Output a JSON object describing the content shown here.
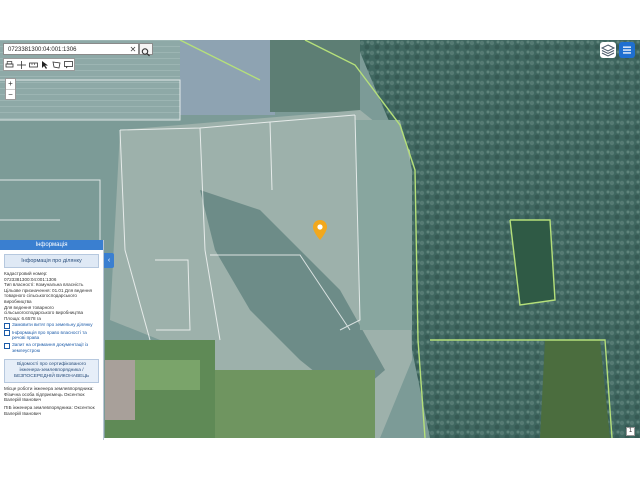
{
  "search": {
    "value": "0723381300:04:001:1306"
  },
  "icons": {
    "search": "magnifier-icon",
    "clear": "close-icon",
    "layers": "layers-icon",
    "menu": "hamburger-icon",
    "pin": "map-pin-icon"
  },
  "zoom": {
    "in_label": "+",
    "out_label": "−"
  },
  "info_panel": {
    "header": "Інформація",
    "title": "Інформація про ділянку",
    "lines": [
      "Кадастровий номер:",
      "0723381300:04:001:1306",
      "Тип власності: Комунальна власність",
      "Цільове призначення: 01.01 Для ведення товарного сільськогосподарського виробництва",
      "Для ведення товарного сільськогосподарського виробництва",
      "Площа: 6.6578 га"
    ],
    "links": [
      "Замовити витяг про земельну ділянку",
      "Інформація про право власності та речові права",
      "Запит на отримання документації із землеустрою"
    ],
    "cert_title": "Відомості про сертифікованого інженера-землевпорядника / БЕЗПОСЕРЕДНІЙ ВИКОНАВЕЦЬ",
    "details": [
      "Місце роботи інженера землевпорядника: Фізична особа підприємець Оксентюк Валерій Іванович",
      "ПІБ інженера землевпорядника: Оксентюк Валерій Іванович"
    ]
  },
  "collapse_tab": "‹",
  "corner": "1",
  "colors": {
    "panel_header": "#3a7fd0",
    "parcel_boundary": "#ffffff",
    "admin_boundary": "#b5e07a",
    "pin": "#f2a81d"
  }
}
